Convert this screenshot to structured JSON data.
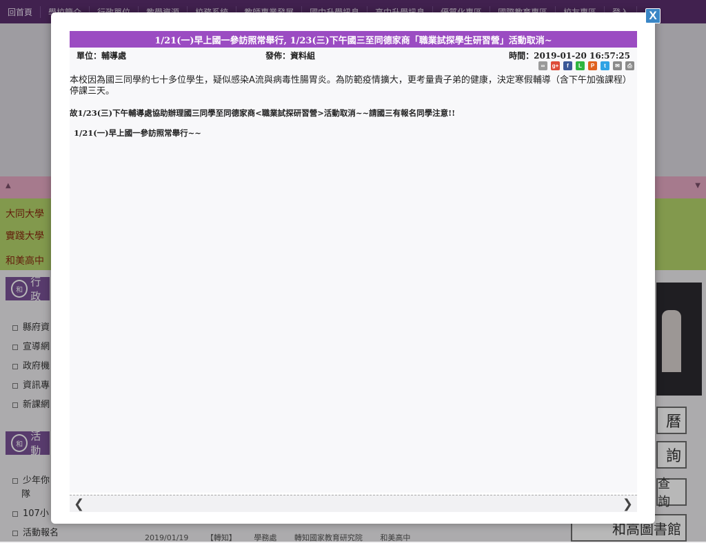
{
  "background": {
    "nav_items": [
      "回首頁",
      "學校簡介",
      "行政單位",
      "教學資源",
      "校務系統",
      "教師專業發展",
      "國中升學訊息",
      "高中升學訊息",
      "優質化專區",
      "國際教育專區",
      "校友專區",
      "登入"
    ],
    "marquee": [
      "大同大學",
      "實踐大學",
      "和美高中"
    ],
    "panel1_title": "行政",
    "panel1_links": [
      "縣府資",
      "宣導網",
      "政府機",
      "資訊專",
      "新課網"
    ],
    "panel2_title": "活動",
    "panel2_links": [
      "少年你",
      "隊",
      "107小",
      "活動報名"
    ],
    "right_buttons": [
      "曆",
      "詢",
      "查詢",
      "和高圖書館"
    ],
    "bottom_row": [
      "2019/01/19",
      "【轉知】",
      "學務處",
      "轉知國家教育研究院",
      "和美高中"
    ]
  },
  "modal": {
    "close_label": "X",
    "title": "1/21(一)早上國一參訪照常舉行, 1/23(三)下午國三至同德家商「職業試探學生研習營」活動取消~",
    "unit": "單位：輔導處",
    "publisher": "發佈：資料組",
    "time": "時間：2019-01-20 16:57:25",
    "share_icons": [
      "link-icon",
      "google-plus-icon",
      "facebook-icon",
      "line-icon",
      "plurk-icon",
      "twitter-icon",
      "email-icon",
      "print-icon"
    ],
    "paragraph": "本校因為國三同學約七十多位學生，疑似感染A流與病毒性腸胃炎。為防範疫情擴大，更考量貴子弟的健康，決定寒假輔導（含下午加強課程）停課三天。",
    "line2": "故1/23(三)下午輔導處協助辦理國三同學至同德家商<職業試探研習營>活動取消~~請國三有報名同學注意!!",
    "line3": "1/21(一)早上國一參訪照常舉行~~",
    "prev_label": "❮",
    "next_label": "❯"
  }
}
